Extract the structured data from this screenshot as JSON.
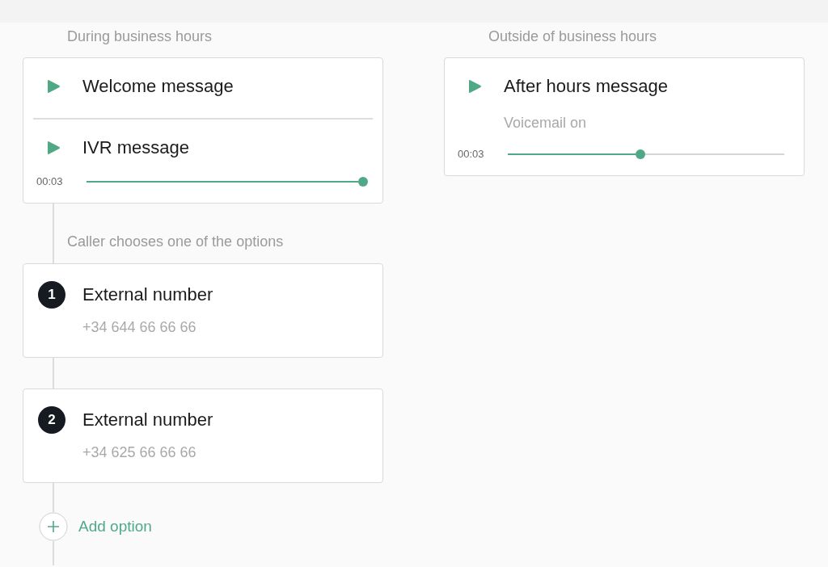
{
  "columns": [
    {
      "heading": "During business hours",
      "messages": [
        {
          "title": "Welcome message"
        },
        {
          "title": "IVR message",
          "player": {
            "time": "00:03",
            "level": 1
          }
        }
      ],
      "options_caption": "Caller chooses one of the options",
      "options": [
        {
          "number": "1",
          "title": "External number",
          "phone": "+34 644 66 66 66"
        },
        {
          "number": "2",
          "title": "External number",
          "phone": "+34 625 66 66 66"
        }
      ],
      "add_option": {
        "label": "Add option"
      }
    },
    {
      "heading": "Outside of business hours",
      "messages": [
        {
          "title": "After hours message",
          "subtitle": "Voicemail on",
          "player": {
            "time": "00:03",
            "level": 0.48
          }
        }
      ]
    }
  ]
}
